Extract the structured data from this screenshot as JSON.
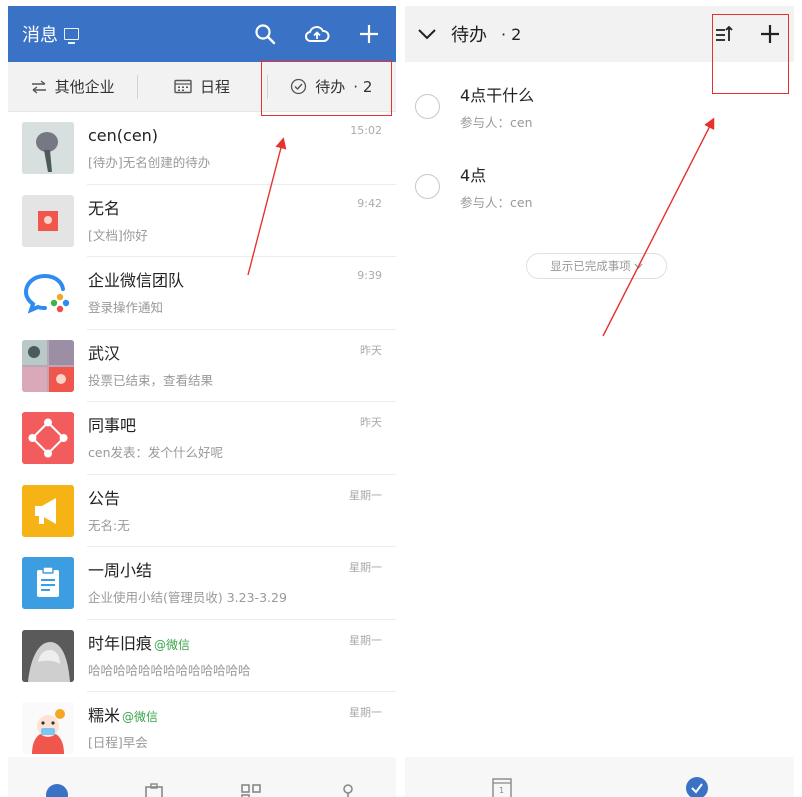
{
  "left": {
    "header": {
      "title": "消息"
    },
    "filters": [
      {
        "label": "其他企业",
        "icon": "swap-icon"
      },
      {
        "label": "日程",
        "icon": "calendar-icon"
      },
      {
        "label": "待办",
        "count": "· 2",
        "icon": "check-circle-icon"
      }
    ],
    "chats": [
      {
        "name": "cen(cen)",
        "tag": "",
        "preview": "[待办]无名创建的待办",
        "time": "15:02",
        "avatar_color": "#c9d6d4"
      },
      {
        "name": "无名",
        "tag": "",
        "preview": "[文档]你好",
        "time": "9:42",
        "avatar_color": "#e7e7e7"
      },
      {
        "name": "企业微信团队",
        "tag": "",
        "preview": "登录操作通知",
        "time": "9:39",
        "avatar_color": "#ffffff"
      },
      {
        "name": "武汉",
        "tag": "",
        "preview": "投票已结束，查看结果",
        "time": "昨天",
        "avatar_color": "#b9a7b9"
      },
      {
        "name": "同事吧",
        "tag": "",
        "preview": "cen发表：发个什么好呢",
        "time": "昨天",
        "avatar_color": "#f25c5c"
      },
      {
        "name": "公告",
        "tag": "",
        "preview": "无名:无",
        "time": "星期一",
        "avatar_color": "#f5b316"
      },
      {
        "name": "一周小结",
        "tag": "",
        "preview": "企业使用小结(管理员收) 3.23-3.29",
        "time": "星期一",
        "avatar_color": "#3c9ee0"
      },
      {
        "name": "时年旧痕",
        "tag": "@微信",
        "preview": "哈哈哈哈哈哈哈哈哈哈哈哈哈",
        "time": "星期一",
        "avatar_color": "#6b6b6b"
      },
      {
        "name": "糯米",
        "tag": "@微信",
        "preview": "[日程]早会",
        "time": "星期一",
        "avatar_color": "#f5f5f5"
      }
    ]
  },
  "right": {
    "header": {
      "title": "待办",
      "count": "· 2"
    },
    "todos": [
      {
        "title": "4点干什么",
        "participants": "参与人：cen"
      },
      {
        "title": "4点",
        "participants": "参与人：cen"
      }
    ],
    "show_completed": "显示已完成事项"
  },
  "colors": {
    "brand": "#3a73c5",
    "annotation": "#e8302f"
  }
}
